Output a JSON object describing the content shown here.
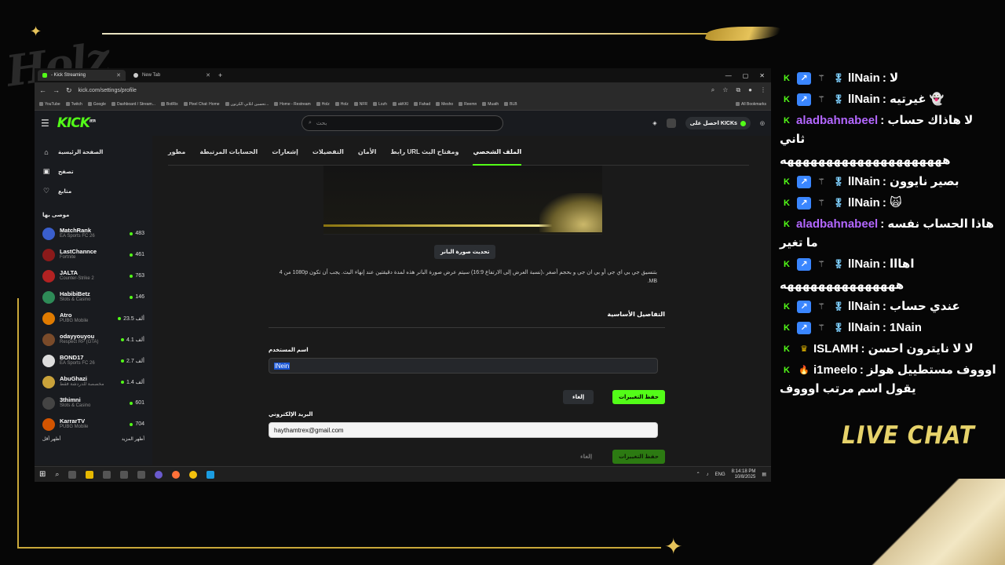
{
  "overlay": {
    "streamer_logo": "Holz",
    "live_chat_label": "LIVE CHAT",
    "accent_color": "#e6c35a"
  },
  "browser": {
    "tabs": [
      {
        "label": "- Kick Streaming",
        "active": true
      },
      {
        "label": "New Tab",
        "active": false
      }
    ],
    "url": "kick.com/settings/profile",
    "bookmarks": [
      "YouTube",
      "Twitch",
      "Google",
      "Dashboard / Stream...",
      "BotRix",
      "Pixel Chat: Home",
      "تحسين اتلاني الكرتون...",
      "Home - Restream",
      "Holz",
      "Holz",
      "NFR",
      "Lozh",
      "akKKl",
      "Fahad",
      "Mesho",
      "Reemn",
      "Muath",
      "BLB"
    ],
    "all_bookmarks": "All Bookmarks"
  },
  "kick": {
    "logo": "KICK",
    "logo_tag": "BETA",
    "search_placeholder": "بحث",
    "get_kicks": "احصل على KICKs",
    "nav": [
      {
        "label": "الصفحة الرئيسية",
        "icon": "home-icon"
      },
      {
        "label": "تصفح",
        "icon": "browse-icon"
      },
      {
        "label": "متابع",
        "icon": "heart-icon"
      }
    ],
    "recommended_title": "موصى بها",
    "channels": [
      {
        "name": "MatchRank",
        "game": "EA Sports FC 26",
        "viewers": "483"
      },
      {
        "name": "LastChannce",
        "game": "Fortnite",
        "viewers": "461"
      },
      {
        "name": "JALTA",
        "game": "Counter-Strike 2",
        "viewers": "763"
      },
      {
        "name": "HabibiBetz",
        "game": "Slots & Casino",
        "viewers": "146"
      },
      {
        "name": "Atro",
        "game": "PUBG Mobile",
        "viewers": "23.5 ألف"
      },
      {
        "name": "odayyouyou",
        "game": "Respect RP (GTA)",
        "viewers": "4.1 ألف"
      },
      {
        "name": "BOND17",
        "game": "EA Sports FC 26",
        "viewers": "2.7 ألف"
      },
      {
        "name": "AbuGhazi",
        "game": "مخصصة للدردشة فقط",
        "viewers": "1.4 ألف"
      },
      {
        "name": "3thimni",
        "game": "Slots & Casino",
        "viewers": "601"
      },
      {
        "name": "KarrarTV",
        "game": "PUBG Mobile",
        "viewers": "704"
      }
    ],
    "show_more": "أظهر المزيد",
    "show_less": "أظهر أقل",
    "settings_tabs": [
      "الملف الشخصي",
      "رابط URL ومفتاح البث",
      "الأمان",
      "التفضيلات",
      "إشعارات",
      "الحسابات المرتبطة",
      "مطور"
    ],
    "update_banner_btn": "تحديث صورة البانر",
    "banner_help": "بتنسيق جي بي اي جي أو بي ان جي و بحجم أصغر ،(نسبة العرض إلى الارتفاع 16:9) سيتم عرض صورة البانر هذه لمدة دقيقتين عند إنهاء البث. يجب أن تكون 1080p من 4 MB.",
    "basic_details": "التفاصيل الأساسية",
    "username_label": "اسم المستخدم",
    "username_value": "lNein",
    "cancel": "إلغاء",
    "save_changes": "حفظ التغييرات",
    "email_label": "البريد الإلكتروني",
    "email_value": "haythamtrex@gmail.com"
  },
  "taskbar": {
    "lang": "ENG",
    "time": "8:14:18 PM",
    "date": "10/8/2025"
  },
  "chat": [
    {
      "user": "llNain",
      "badges": [
        "K",
        "B",
        "S",
        "G"
      ],
      "color": "#ffffff",
      "text": "لا"
    },
    {
      "user": "llNain",
      "badges": [
        "K",
        "B",
        "S",
        "G"
      ],
      "color": "#ffffff",
      "text": "غيرتيه 👻"
    },
    {
      "user": "aladbahnabeel",
      "badges": [
        "K"
      ],
      "color": "#b367ff",
      "text": "لا هاذاك حساب ثاني"
    },
    {
      "user": "",
      "badges": [],
      "color": "#ffffff",
      "text": "هههههههههههههههههههههه"
    },
    {
      "user": "llNain",
      "badges": [
        "K",
        "B",
        "S",
        "G"
      ],
      "color": "#ffffff",
      "text": "بصير نايوون"
    },
    {
      "user": "llNain",
      "badges": [
        "K",
        "B",
        "S",
        "G"
      ],
      "color": "#ffffff",
      "text": "🙀"
    },
    {
      "user": "aladbahnabeel",
      "badges": [
        "K"
      ],
      "color": "#b367ff",
      "text": "هاذا الحساب نفسه ما تغير"
    },
    {
      "user": "llNain",
      "badges": [
        "K",
        "B",
        "S",
        "G"
      ],
      "color": "#ffffff",
      "text": "اهااا"
    },
    {
      "user": "",
      "badges": [],
      "color": "#ffffff",
      "text": "هههههههههههههههه"
    },
    {
      "user": "llNain",
      "badges": [
        "K",
        "B",
        "S",
        "G"
      ],
      "color": "#ffffff",
      "text": "عندي حساب"
    },
    {
      "user": "llNain",
      "badges": [
        "K",
        "B",
        "S",
        "G"
      ],
      "color": "#ffffff",
      "text": "1Nain"
    },
    {
      "user": "ISLAMH",
      "badges": [
        "K",
        "C"
      ],
      "color": "#ffffff",
      "text": "لا لا نايترون احسن"
    },
    {
      "user": "i1meelo",
      "badges": [
        "K",
        "F"
      ],
      "color": "#ffffff",
      "text": "اوووف مستطييل هولز يقول اسم مرتب اوووف"
    }
  ]
}
